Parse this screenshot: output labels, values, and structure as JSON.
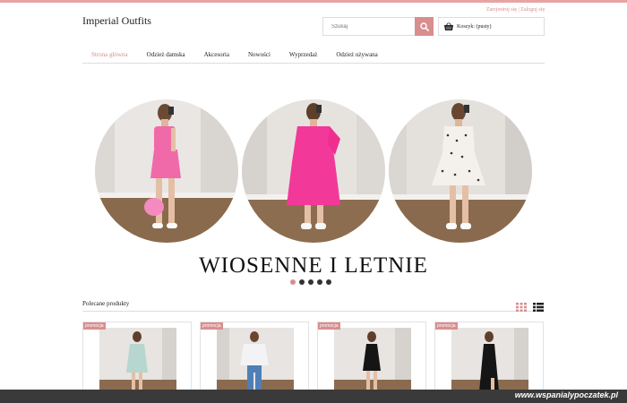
{
  "header": {
    "register_label": "Zarejestruj się",
    "separator": "|",
    "login_label": "Zaloguj się",
    "logo": "Imperial Outfits",
    "search_placeholder": "Szukaj",
    "search_icon": "search-icon",
    "cart_icon": "basket-icon",
    "cart_label": "Koszyk: (pusty)"
  },
  "nav": {
    "items": [
      {
        "label": "Strona główna",
        "active": true
      },
      {
        "label": "Odzież damska",
        "active": false
      },
      {
        "label": "Akcesoria",
        "active": false
      },
      {
        "label": "Nowości",
        "active": false
      },
      {
        "label": "Wyprzedaż",
        "active": false
      },
      {
        "label": "Odzież używana",
        "active": false
      }
    ]
  },
  "slider": {
    "title": "WIOSENNE I LETNIE",
    "dots_count": 5,
    "active_dot": 1
  },
  "products_section": {
    "title": "Polecane produkty",
    "grid_icon": "grid-view-icon",
    "list_icon": "list-view-icon",
    "cards": [
      {
        "badge": "promocja"
      },
      {
        "badge": "promocja"
      },
      {
        "badge": "promocja"
      },
      {
        "badge": "promocja"
      }
    ]
  },
  "watermark": "www.wspanialypoczatek.pl",
  "colors": {
    "accent": "#d98e8e",
    "topbar": "#e8a3a3",
    "footer": "#3a3a3a"
  }
}
